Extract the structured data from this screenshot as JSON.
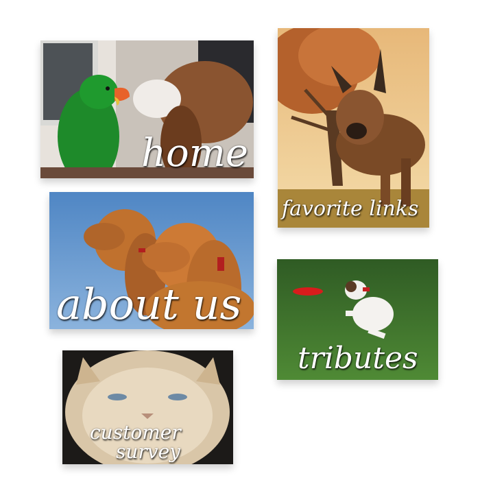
{
  "nav": {
    "home": {
      "label": "home",
      "icon": "parrot-and-basset-hound-photo"
    },
    "favorite_links": {
      "label": "favorite links",
      "icon": "german-shepherd-under-tree-photo"
    },
    "about_us": {
      "label": "about us",
      "icon": "two-cocker-spaniels-photo"
    },
    "tributes": {
      "label": "tributes",
      "icon": "jack-russell-catching-frisbee-photo"
    },
    "customer_survey": {
      "label_line1": "customer",
      "label_line2": "survey",
      "icon": "grumpy-persian-cat-photo"
    }
  },
  "colors": {
    "background": "#ffffff",
    "label_text": "#ffffff",
    "parrot_green": "#1e8a2a",
    "frisbee_red": "#d81c1c",
    "sky_blue": "#5b8fc9",
    "grass_green": "#3f7a2e"
  }
}
